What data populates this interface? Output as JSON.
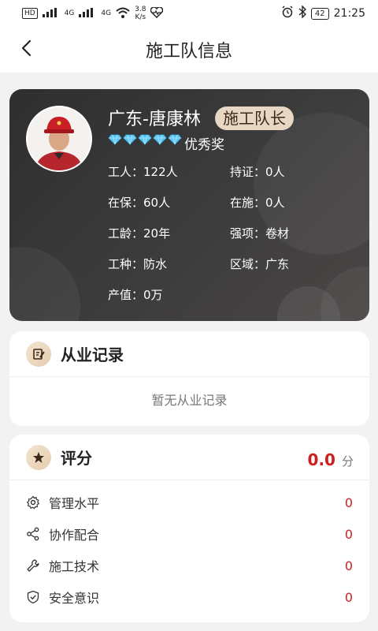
{
  "status_bar": {
    "network_label": "HD",
    "signal1": "4G",
    "signal2": "4G",
    "speed_value": "3.8",
    "speed_unit": "K/s",
    "battery": "42",
    "time": "21:25"
  },
  "nav": {
    "title": "施工队信息",
    "back_icon": "chevron-left-icon"
  },
  "profile": {
    "name": "广东-唐康林",
    "role_badge": "施工队长",
    "diamond_count": 5,
    "award": "优秀奖",
    "stats": [
      {
        "label": "工人：",
        "value": "122人"
      },
      {
        "label": "持证：",
        "value": "0人"
      },
      {
        "label": "在保：",
        "value": "60人"
      },
      {
        "label": "在施：",
        "value": "0人"
      },
      {
        "label": "工龄：",
        "value": "20年"
      },
      {
        "label": "强项：",
        "value": "卷材"
      },
      {
        "label": "工种：",
        "value": "防水"
      },
      {
        "label": "区域：",
        "value": "广东"
      },
      {
        "label": "产值：",
        "value": "0万"
      }
    ]
  },
  "work_record": {
    "title": "从业记录",
    "empty_text": "暂无从业记录",
    "icon": "edit-note-icon"
  },
  "rating": {
    "title": "评分",
    "score": "0.0",
    "unit": "分",
    "icon": "star-icon",
    "items": [
      {
        "label": "管理水平",
        "value": "0",
        "icon": "gear-icon"
      },
      {
        "label": "协作配合",
        "value": "0",
        "icon": "share-icon"
      },
      {
        "label": "施工技术",
        "value": "0",
        "icon": "wrench-icon"
      },
      {
        "label": "安全意识",
        "value": "0",
        "icon": "shield-check-icon"
      }
    ]
  },
  "colors": {
    "accent_red": "#cc1f1f",
    "badge_bg": "#e8d7c3",
    "card_dark": "#3a3939"
  }
}
